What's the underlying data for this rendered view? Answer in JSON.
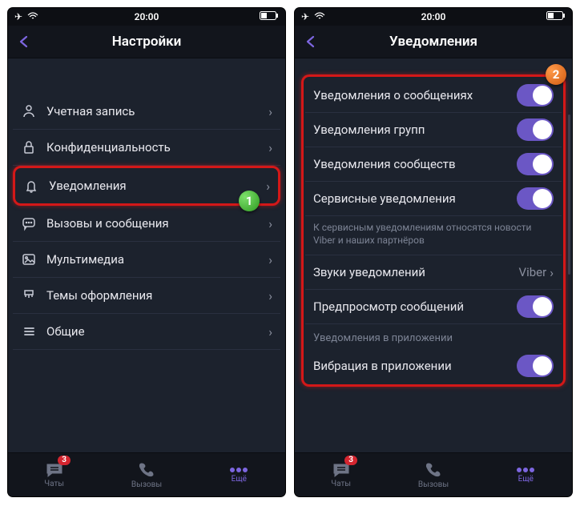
{
  "status": {
    "time": "20:00"
  },
  "left": {
    "title": "Настройки",
    "items": [
      {
        "label": "Учетная запись",
        "icon": "account-icon"
      },
      {
        "label": "Конфиденциальность",
        "icon": "lock-icon"
      },
      {
        "label": "Уведомления",
        "icon": "bell-icon"
      },
      {
        "label": "Вызовы и сообщения",
        "icon": "chat-icon"
      },
      {
        "label": "Мультимедиа",
        "icon": "media-icon"
      },
      {
        "label": "Темы оформления",
        "icon": "brush-icon"
      },
      {
        "label": "Общие",
        "icon": "list-icon"
      }
    ],
    "highlight_index": 2,
    "callout": "1"
  },
  "right": {
    "title": "Уведомления",
    "callout": "2",
    "toggles": [
      {
        "label": "Уведомления о сообщениях",
        "on": true
      },
      {
        "label": "Уведомления групп",
        "on": true
      },
      {
        "label": "Уведомления сообществ",
        "on": true
      },
      {
        "label": "Сервисные уведомления",
        "on": true
      }
    ],
    "note": "К сервисным уведомлениям относятся новости Viber и наших партнёров",
    "sound_row": {
      "label": "Звуки уведомлений",
      "value": "Viber"
    },
    "preview_row": {
      "label": "Предпросмотр сообщений",
      "on": true
    },
    "section_header": "Уведомления в приложении",
    "vibration_row": {
      "label": "Вибрация в приложении",
      "on": true
    }
  },
  "tabs": {
    "chats": "Чаты",
    "calls": "Вызовы",
    "more": "Ещё",
    "badge": "3"
  }
}
